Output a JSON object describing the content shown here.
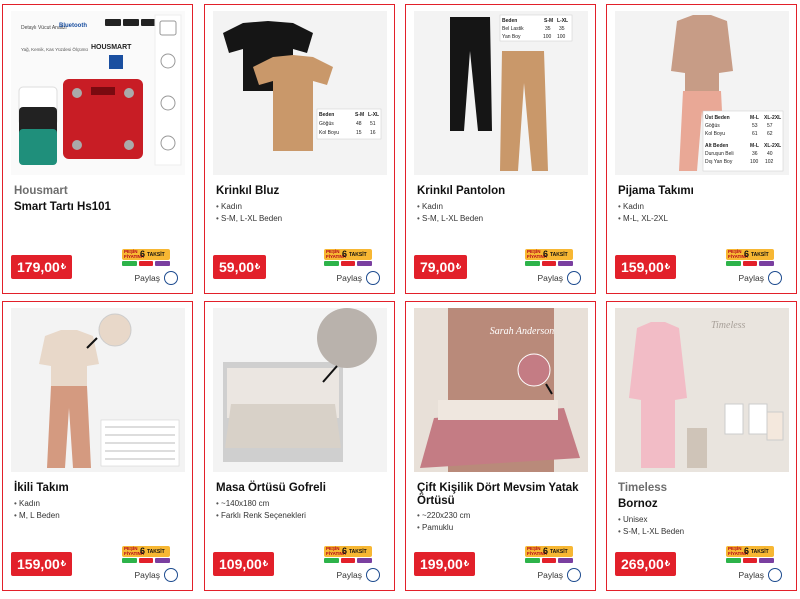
{
  "colors": {
    "accent": "#e2202a",
    "share_ring": "#1d4b8f",
    "taksit_bg": "#f7b733"
  },
  "taksit": {
    "pesin": "PEŞİN FİYATINA",
    "count": "6",
    "label": "TAKSİT"
  },
  "share_label": "Paylaş",
  "currency": "₺",
  "products": [
    {
      "brand": "Housmart",
      "title": "Smart Tartı Hs101",
      "attrs": [],
      "price": "179,00",
      "image": {
        "brand_text": "HOUSMART",
        "tagline": "Detaylı Vücut Analizi",
        "sub": "Yağ, Kemik, Kas Yüzdesi Ölçümü",
        "bluetooth": "Bluetooth"
      }
    },
    {
      "brand": "",
      "title": "Krinkıl Bluz",
      "attrs": [
        "Kadın",
        "S-M, L-XL Beden"
      ],
      "price": "59,00",
      "image": {
        "table_head": [
          "Beden",
          "S-M",
          "L-XL"
        ],
        "rows": [
          [
            "Göğüs",
            "48",
            "51"
          ],
          [
            "Kol Boyu",
            "15",
            "16"
          ]
        ]
      }
    },
    {
      "brand": "",
      "title": "Krinkıl Pantolon",
      "attrs": [
        "Kadın",
        "S-M, L-XL Beden"
      ],
      "price": "79,00",
      "image": {
        "table_head": [
          "Beden",
          "S-M",
          "L-XL"
        ],
        "rows": [
          [
            "Bel Lastik",
            "35",
            "35"
          ],
          [
            "Yan Boy",
            "100",
            "100"
          ]
        ]
      }
    },
    {
      "brand": "",
      "title": "Pijama Takımı",
      "attrs": [
        "Kadın",
        "M-L, XL-2XL"
      ],
      "price": "159,00",
      "image": {
        "table_head": [
          "Üst Beden",
          "M-L",
          "XL-2XL"
        ],
        "rows": [
          [
            "Göğüs",
            "53",
            "57"
          ],
          [
            "Kol Boyu",
            "61",
            "62"
          ]
        ],
        "table_head2": [
          "Alt Beden",
          "M-L",
          "XL-2XL"
        ],
        "rows2": [
          [
            "Duruşun Beli",
            "36",
            "40"
          ],
          [
            "Dış Yan Boy",
            "100",
            "102"
          ]
        ]
      }
    },
    {
      "brand": "",
      "title": "İkili Takım",
      "attrs": [
        "Kadın",
        "M, L Beden"
      ],
      "price": "159,00",
      "image": {}
    },
    {
      "brand": "",
      "title": "Masa Örtüsü Gofreli",
      "attrs": [
        "~140x180 cm",
        "Farklı Renk Seçenekleri"
      ],
      "price": "109,00",
      "image": {}
    },
    {
      "brand": "",
      "title": "Çift Kişilik Dört Mevsim Yatak Örtüsü",
      "attrs": [
        "~220x230 cm",
        "Pamuklu"
      ],
      "price": "199,00",
      "image": {
        "wall_text": "Sarah Anderson"
      }
    },
    {
      "brand": "Timeless",
      "title": "Bornoz",
      "attrs": [
        "Unisex",
        "S-M, L-XL Beden"
      ],
      "price": "269,00",
      "image": {
        "wall_text": "Timeless"
      }
    }
  ]
}
